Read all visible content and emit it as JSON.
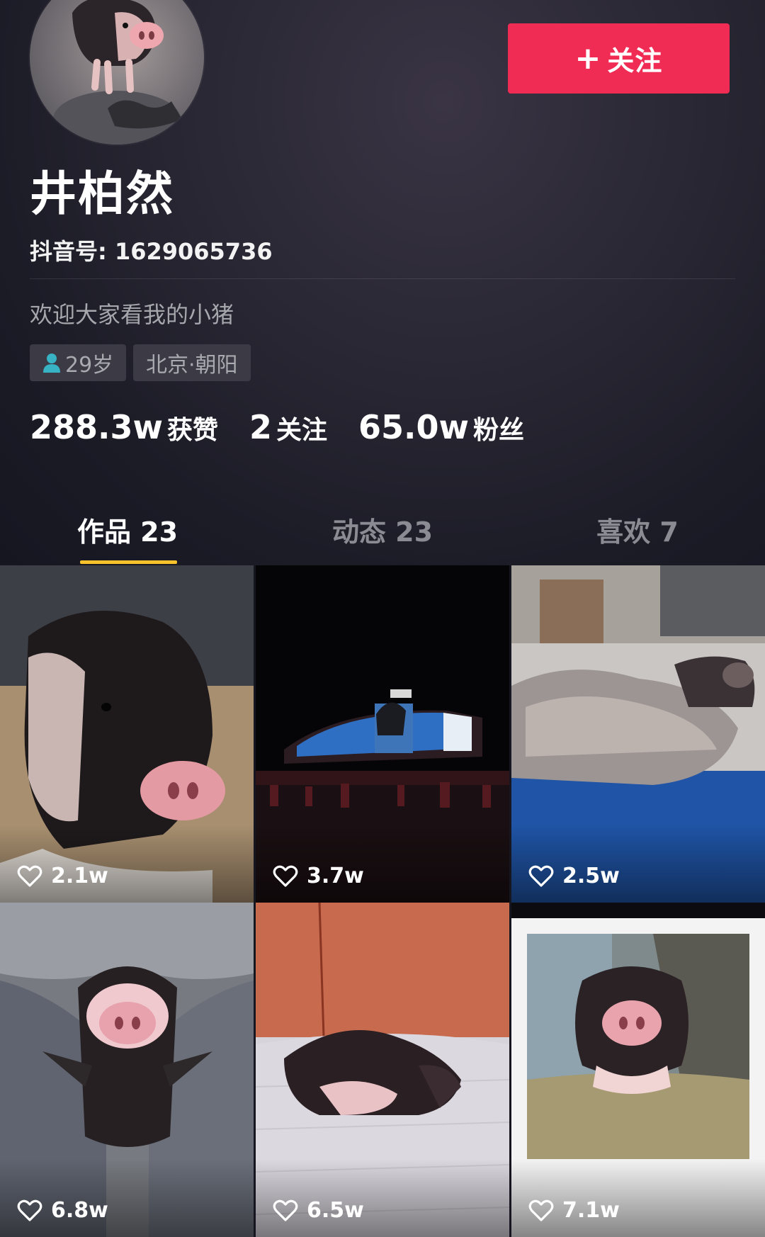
{
  "profile": {
    "display_name": "井柏然",
    "douyin_id": "抖音号: 1629065736",
    "bio": "欢迎大家看我的小猪",
    "tags": {
      "age": "29岁",
      "location": "北京·朝阳"
    }
  },
  "follow_button": {
    "plus": "+",
    "label": "关注",
    "color": "#f02c55"
  },
  "stats": {
    "likes": {
      "value": "288.3w",
      "label": "获赞"
    },
    "following": {
      "value": "2",
      "label": "关注"
    },
    "followers": {
      "value": "65.0w",
      "label": "粉丝"
    }
  },
  "tabs": [
    {
      "label": "作品 23",
      "active": true
    },
    {
      "label": "动态 23",
      "active": false
    },
    {
      "label": "喜欢 7",
      "active": false
    }
  ],
  "tab_indicator_color": "#f8c22d",
  "videos": [
    {
      "likes": "2.1w",
      "icon": "heart-outline-icon"
    },
    {
      "likes": "3.7w",
      "icon": "heart-outline-icon"
    },
    {
      "likes": "2.5w",
      "icon": "heart-outline-icon"
    },
    {
      "likes": "6.8w",
      "icon": "heart-outline-icon"
    },
    {
      "likes": "6.5w",
      "icon": "heart-outline-icon"
    },
    {
      "likes": "7.1w",
      "icon": "heart-outline-icon"
    }
  ]
}
